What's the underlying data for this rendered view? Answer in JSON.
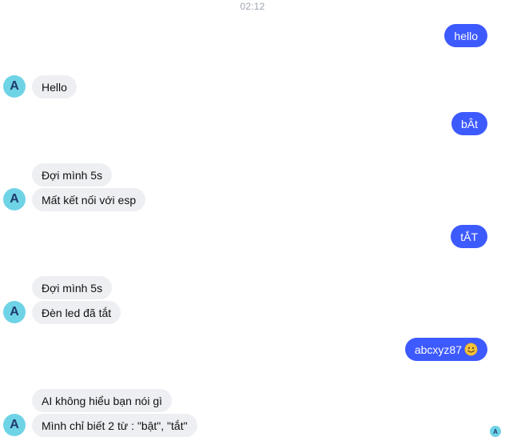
{
  "timestamp": "02:12",
  "avatar_letter": "A",
  "seen_letter": "A",
  "messages": {
    "m1": "hello",
    "m2": "Hello",
    "m3": "bÂt",
    "m4": "Đợi mình 5s",
    "m5": "Mất kết nối với esp",
    "m6": "tẮT",
    "m7": "Đợi mình 5s",
    "m8": "Đèn led đã tắt",
    "m9": "abcxyz87",
    "m10": "AI không hiểu bạn nói gì",
    "m11": "Mình chỉ biết 2 từ : \"bật\", \"tắt\""
  },
  "icons": {
    "emoji": "slightly-smiling-face-icon"
  },
  "colors": {
    "outgoing_bubble": "#3d5afe",
    "incoming_bubble": "#eeeff2",
    "avatar": "#6fd3e6"
  }
}
